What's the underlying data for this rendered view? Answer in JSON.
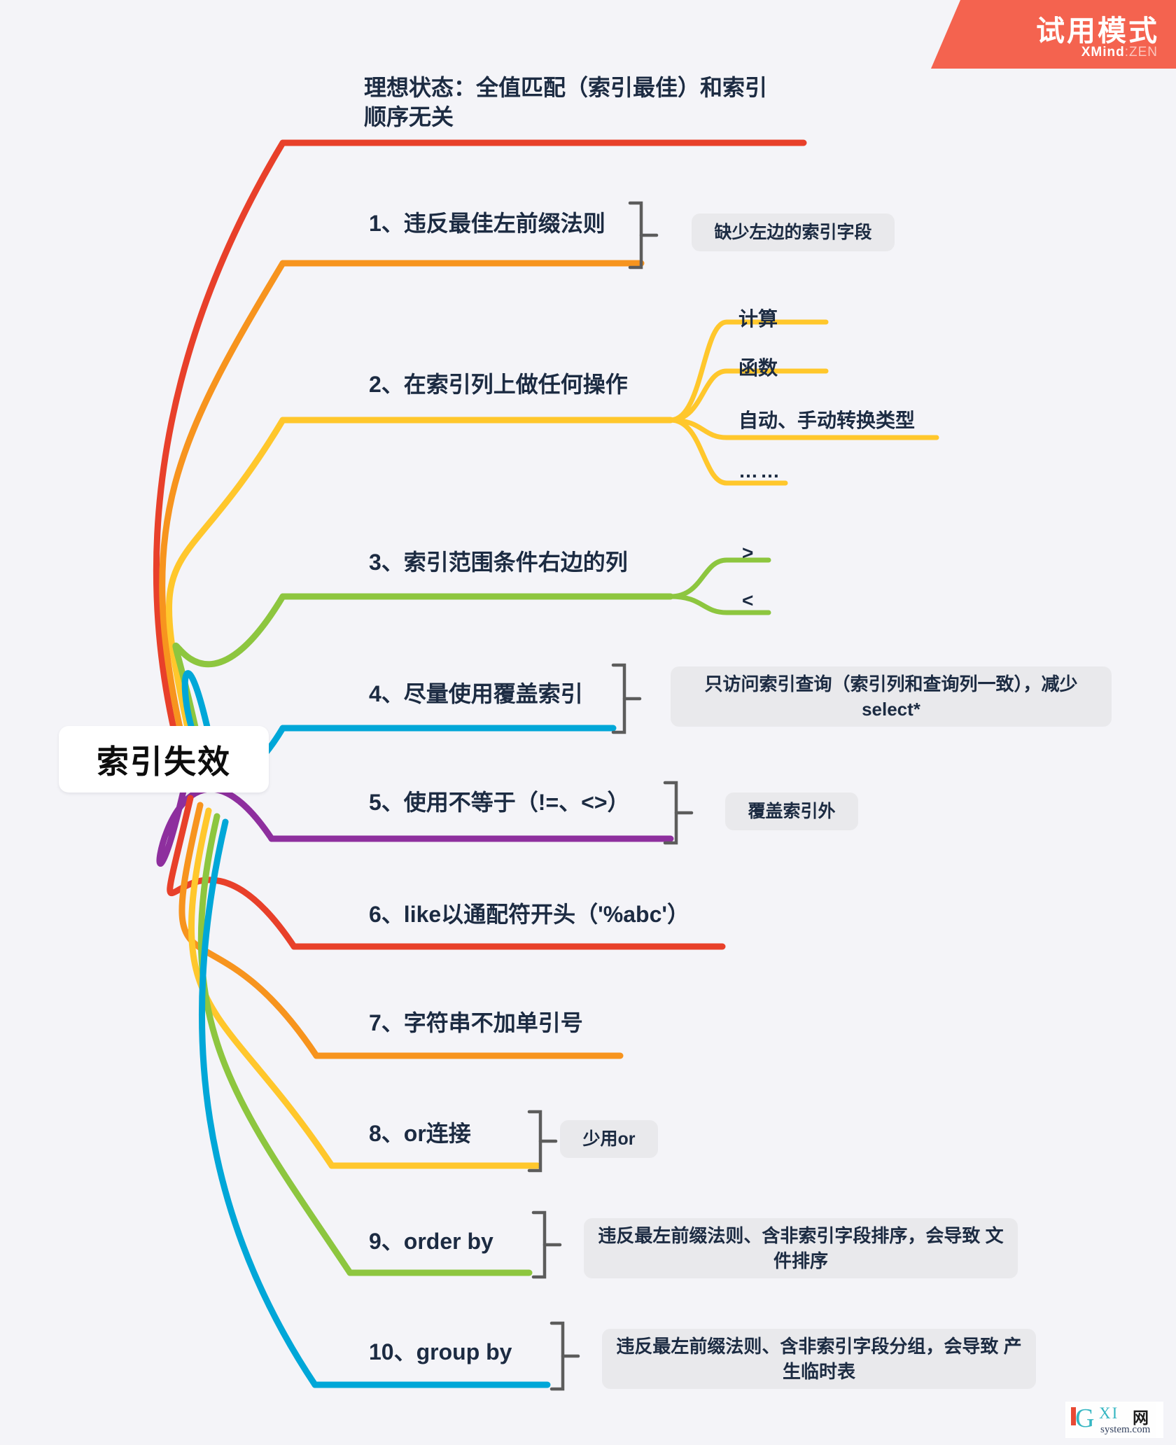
{
  "badge": {
    "title": "试用模式",
    "brand_main": "XMind",
    "brand_sep": ":",
    "brand_sub": "ZEN",
    "color": "#f4634f"
  },
  "watermark": {
    "letter": "G",
    "mid": "XI",
    "net": "网",
    "site": "system.com"
  },
  "central": {
    "label": "索引失效"
  },
  "colors": {
    "red": "#e8402a",
    "orange": "#f7941e",
    "yellow": "#ffc72c",
    "green": "#8dc63f",
    "cyan": "#00a7d8",
    "purple": "#8e2f9e",
    "text": "#1c2b42",
    "note_bg": "#e9e9ec",
    "background": "#f4f4f8"
  },
  "branches": [
    {
      "id": "ideal-state",
      "label": "理想状态：全值匹配（索引最佳）和索引\n顺序无关",
      "color": "#e8402a",
      "note": null,
      "children": []
    },
    {
      "id": "rule-1",
      "label": "1、违反最佳左前缀法则",
      "color": "#f7941e",
      "note": "缺少左边的索引字段",
      "children": []
    },
    {
      "id": "rule-2",
      "label": "2、在索引列上做任何操作",
      "color": "#ffc72c",
      "note": null,
      "children": [
        {
          "label": "计算"
        },
        {
          "label": "函数"
        },
        {
          "label": "自动、手动转换类型"
        },
        {
          "label": "……"
        }
      ]
    },
    {
      "id": "rule-3",
      "label": "3、索引范围条件右边的列",
      "color": "#8dc63f",
      "note": null,
      "children": [
        {
          "label": ">"
        },
        {
          "label": "<"
        }
      ]
    },
    {
      "id": "rule-4",
      "label": "4、尽量使用覆盖索引",
      "color": "#00a7d8",
      "note": "只访问索引查询（索引列和查询列一致），减少\nselect*",
      "children": []
    },
    {
      "id": "rule-5",
      "label": "5、使用不等于（!=、<>）",
      "color": "#8e2f9e",
      "note": "覆盖索引外",
      "children": []
    },
    {
      "id": "rule-6",
      "label": "6、like以通配符开头（'%abc'）",
      "color": "#e8402a",
      "note": null,
      "children": []
    },
    {
      "id": "rule-7",
      "label": "7、字符串不加单引号",
      "color": "#f7941e",
      "note": null,
      "children": []
    },
    {
      "id": "rule-8",
      "label": "8、or连接",
      "color": "#ffc72c",
      "note": "少用or",
      "children": []
    },
    {
      "id": "rule-9",
      "label": "9、order by",
      "color": "#8dc63f",
      "note": "违反最左前缀法则、含非索引字段排序，会导致\n文件排序",
      "children": []
    },
    {
      "id": "rule-10",
      "label": "10、group by",
      "color": "#00a7d8",
      "note": "违反最左前缀法则、含非索引字段分组，会导致\n产生临时表",
      "children": []
    }
  ]
}
